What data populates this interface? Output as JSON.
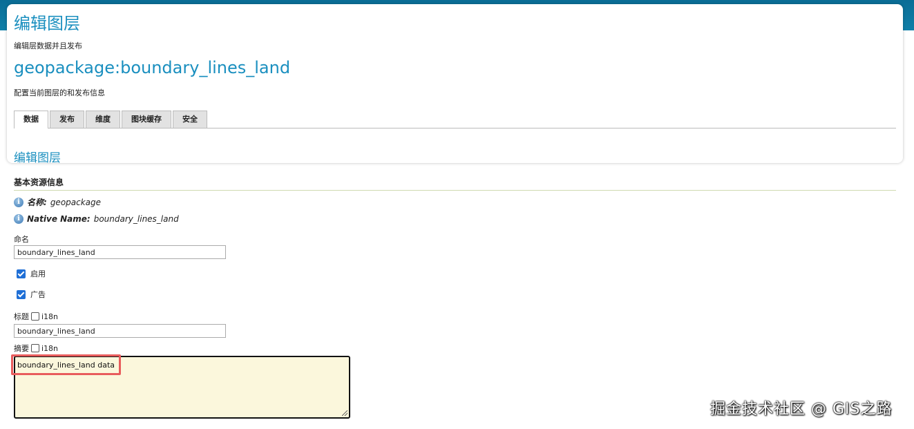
{
  "header": {
    "title": "编辑图层",
    "subtitle": "编辑层数据并且发布",
    "layer_name": "geopackage:boundary_lines_land",
    "layer_subtitle": "配置当前图层的和发布信息"
  },
  "tabs": [
    {
      "label": "数据",
      "active": true
    },
    {
      "label": "发布",
      "active": false
    },
    {
      "label": "维度",
      "active": false
    },
    {
      "label": "图块缓存",
      "active": false
    },
    {
      "label": "安全",
      "active": false
    }
  ],
  "section": {
    "title": "编辑图层",
    "group_title": "基本资源信息"
  },
  "info": {
    "name_label": "名称:",
    "name_value": "geopackage",
    "native_label": "Native Name:",
    "native_value": "boundary_lines_land",
    "icon": "info-icon"
  },
  "form": {
    "name_label": "命名",
    "name_value": "boundary_lines_land",
    "enabled_label": "启用",
    "enabled_checked": true,
    "advertised_label": "广告",
    "advertised_checked": true,
    "title_label": "标题",
    "title_i18n_label": "i18n",
    "title_value": "boundary_lines_land",
    "abstract_label": "摘要",
    "abstract_i18n_label": "i18n",
    "abstract_value": "boundary_lines_land data"
  },
  "watermark": "掘金技术社区 @ GIS之路",
  "colors": {
    "accent": "#1a8fbf",
    "topbar": "#0f7fa8",
    "textarea_bg": "#fbf7dc",
    "highlight": "#e85c5c",
    "checkbox": "#1f6fd6"
  }
}
